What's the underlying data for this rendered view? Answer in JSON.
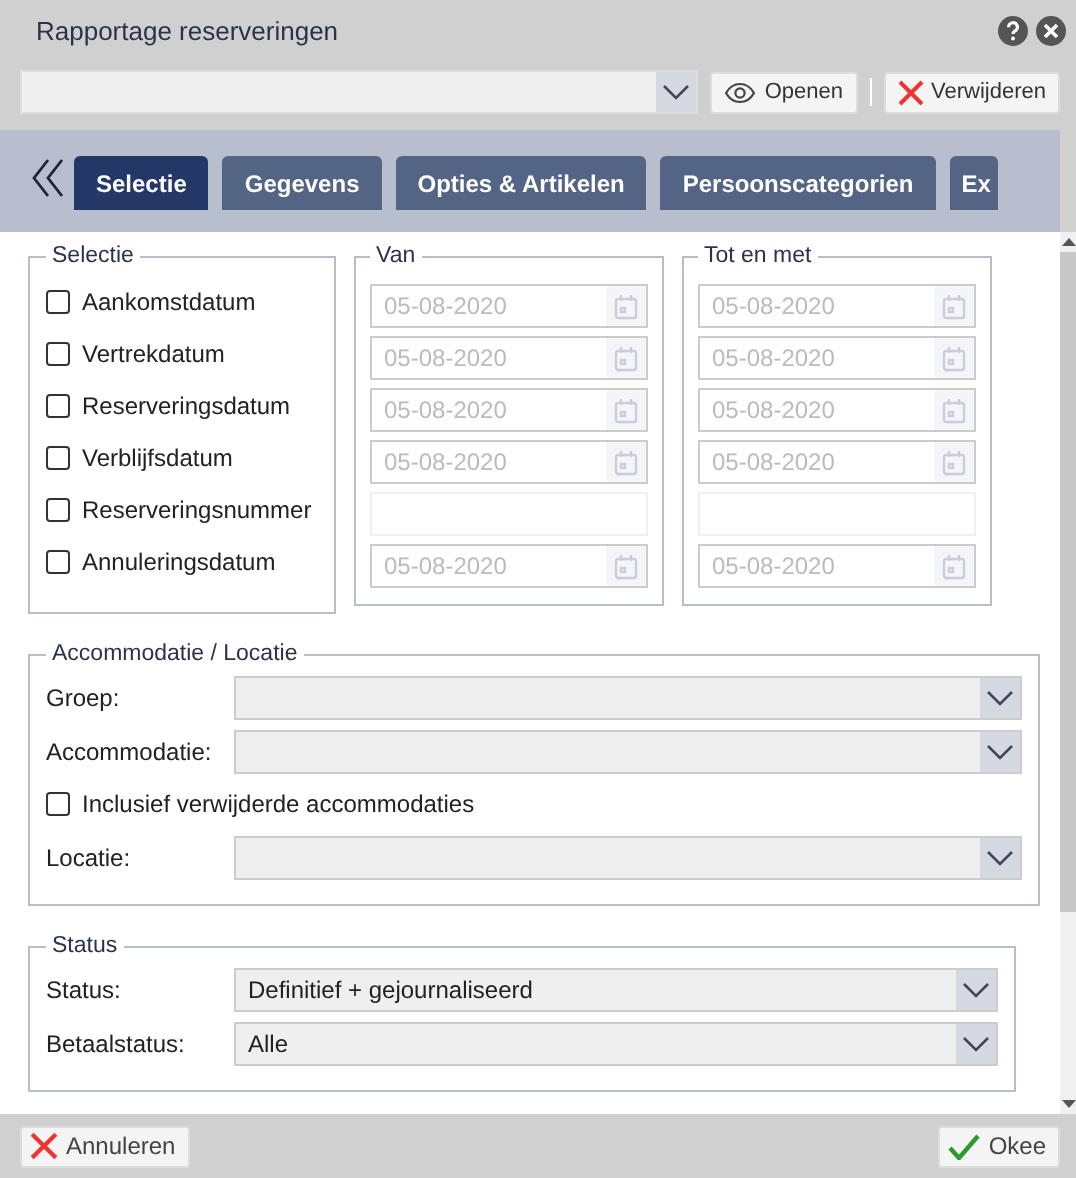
{
  "window": {
    "title": "Rapportage reserveringen"
  },
  "toolbar": {
    "buttons": [
      {
        "kind": "open",
        "label": "Openen"
      },
      {
        "kind": "delete",
        "label": "Verwijderen"
      }
    ]
  },
  "tabs": [
    {
      "label": "Selectie",
      "selected": true
    },
    {
      "label": "Gegevens",
      "selected": false
    },
    {
      "label": "Opties & Artikelen",
      "selected": false
    },
    {
      "label": "Persoonscategorien",
      "selected": false
    },
    {
      "label": "Ex",
      "selected": false
    }
  ],
  "selectie": {
    "legend": "Selectie",
    "items": [
      {
        "label": "Aankomstdatum",
        "checked": false
      },
      {
        "label": "Vertrekdatum",
        "checked": false
      },
      {
        "label": "Reserveringsdatum",
        "checked": false
      },
      {
        "label": "Verblijfsdatum",
        "checked": false
      },
      {
        "label": "Reserveringsnummer",
        "checked": false
      },
      {
        "label": "Annuleringsdatum",
        "checked": false
      }
    ]
  },
  "van": {
    "legend": "Van",
    "fields": [
      {
        "kind": "date",
        "value": "05-08-2020",
        "disabled": true
      },
      {
        "kind": "date",
        "value": "05-08-2020",
        "disabled": true
      },
      {
        "kind": "date",
        "value": "05-08-2020",
        "disabled": true
      },
      {
        "kind": "date",
        "value": "05-08-2020",
        "disabled": true
      },
      {
        "kind": "empty"
      },
      {
        "kind": "date",
        "value": "05-08-2020",
        "disabled": true
      }
    ]
  },
  "tot_en_met": {
    "legend": "Tot en met",
    "fields": [
      {
        "kind": "date",
        "value": "05-08-2020",
        "disabled": true
      },
      {
        "kind": "date",
        "value": "05-08-2020",
        "disabled": true
      },
      {
        "kind": "date",
        "value": "05-08-2020",
        "disabled": true
      },
      {
        "kind": "date",
        "value": "05-08-2020",
        "disabled": true
      },
      {
        "kind": "empty"
      },
      {
        "kind": "date",
        "value": "05-08-2020",
        "disabled": true
      }
    ]
  },
  "accommodatie": {
    "legend": "Accommodatie / Locatie",
    "rows": [
      {
        "kind": "select",
        "label": "Groep:"
      },
      {
        "kind": "select",
        "label": "Accommodatie:"
      },
      {
        "kind": "checkbox",
        "label": "Inclusief verwijderde accommodaties",
        "checked": false
      },
      {
        "kind": "select",
        "label": "Locatie:"
      }
    ]
  },
  "status": {
    "legend": "Status",
    "rows": [
      {
        "kind": "select",
        "label": "Status:",
        "value": "Definitief + gejournaliseerd"
      },
      {
        "kind": "select",
        "label": "Betaalstatus:",
        "value": "Alle"
      }
    ]
  },
  "footer": {
    "buttons": [
      {
        "kind": "cancel",
        "label": "Annuleren"
      },
      {
        "kind": "ok",
        "label": "Okee"
      }
    ]
  }
}
